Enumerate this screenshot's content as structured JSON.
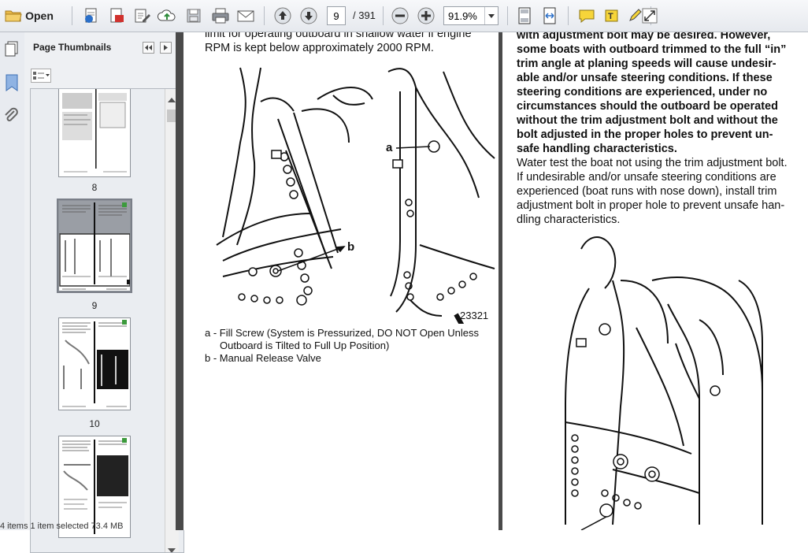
{
  "toolbar": {
    "open_label": "Open",
    "page_current": "9",
    "page_total": "/ 391",
    "zoom": "91.9%"
  },
  "panel": {
    "title": "Page Thumbnails",
    "thumbnails": [
      {
        "label": "8"
      },
      {
        "label": "9"
      },
      {
        "label": "10"
      }
    ]
  },
  "statusbar": {
    "text": "4 items    1 item selected  73.4 MB"
  },
  "document": {
    "left_page": {
      "top_text_line1": "limit for operating outboard in shallow water if engine",
      "top_text_line2": "RPM is kept below approximately 2000 RPM.",
      "figure_number": "23321",
      "label_a": "a",
      "label_b": "b",
      "caption_a_line1": "a - Fill Screw (System is Pressurized, DO NOT Open Unless",
      "caption_a_line2": "Outboard is Tilted to Full Up Position)",
      "caption_b": "b - Manual Release Valve"
    },
    "right_page": {
      "bold_lines": [
        "with adjustment bolt may be desired. However,",
        "some boats with outboard trimmed to the full “in”",
        "trim angle at planing speeds will cause undesir-",
        "able and/or unsafe steering conditions. If these",
        "steering conditions are experienced, under no",
        "circumstances should the outboard be operated",
        "without the trim adjustment bolt and without the",
        "bolt adjusted in the proper holes to prevent un-",
        "safe handling characteristics."
      ],
      "body_lines": [
        "Water test the boat not using the trim adjustment bolt.",
        "If undesirable and/or unsafe steering conditions are",
        "experienced (boat runs with nose down), install trim",
        "adjustment bolt in proper hole to prevent unsafe han-",
        "dling characteristics."
      ]
    }
  }
}
